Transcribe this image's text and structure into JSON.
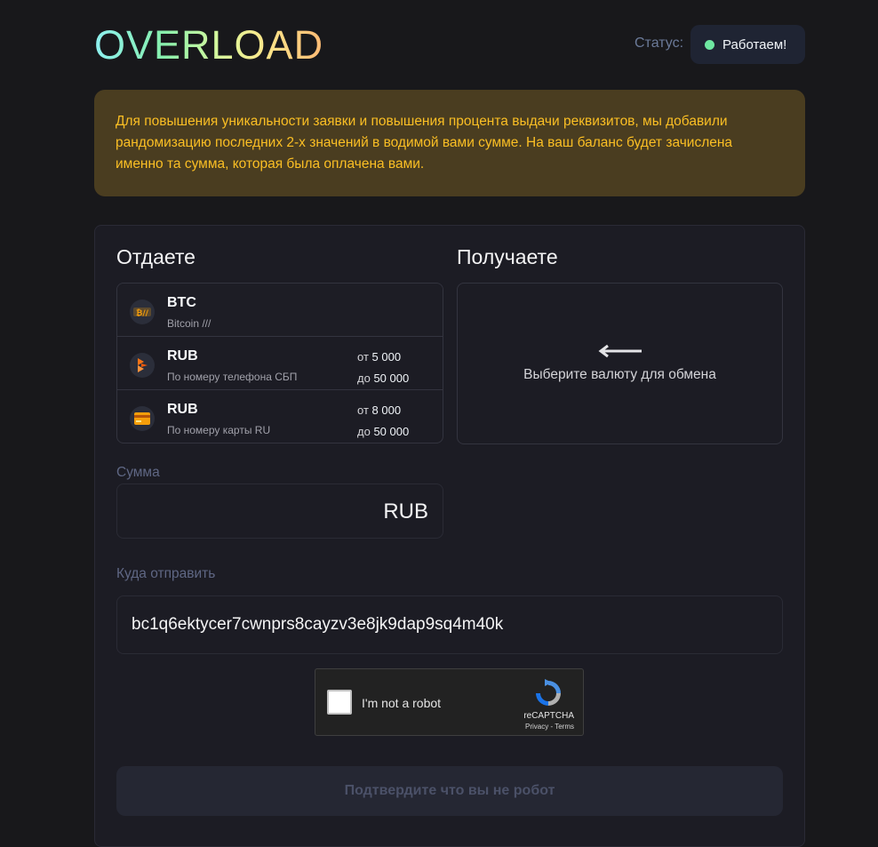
{
  "header": {
    "logo": "OVERLOAD",
    "status_label": "Статус:",
    "status_text": "Работаем!",
    "status_color": "#6ee7a1"
  },
  "notice": {
    "text": "Для повышения уникальности заявки и повышения процента выдачи реквизитов, мы добавили рандомизацию последних 2-х значений в водимой вами сумме. На ваш баланс будет зачислена именно та сумма, которая была оплачена вами."
  },
  "give": {
    "title": "Отдаете",
    "currencies": [
      {
        "code": "BTC",
        "sub": "Bitcoin ///",
        "icon": "bitcoin-icon",
        "min_label": "",
        "min": "",
        "max_label": "",
        "max": ""
      },
      {
        "code": "RUB",
        "sub": "По номеру телефона СБП",
        "icon": "sbp-icon",
        "min_label": "от",
        "min": "5 000",
        "max_label": "до",
        "max": "50 000"
      },
      {
        "code": "RUB",
        "sub": "По номеру карты RU",
        "icon": "card-icon",
        "min_label": "от",
        "min": "8 000",
        "max_label": "до",
        "max": "50 000"
      }
    ]
  },
  "get": {
    "title": "Получаете",
    "hint": "Выберите валюту для обмена",
    "icon": "arrow-left-icon"
  },
  "sum": {
    "label": "Сумма",
    "value": "",
    "currency": "RUB"
  },
  "address": {
    "label": "Куда отправить",
    "value": "bc1q6ektycer7cwnprs8cayzv3e8jk9dap9sq4m40k"
  },
  "captcha": {
    "text": "I'm not a robot",
    "brand": "reCAPTCHA",
    "links": "Privacy - Terms"
  },
  "submit": {
    "label": "Подтвердите что вы не робот"
  }
}
